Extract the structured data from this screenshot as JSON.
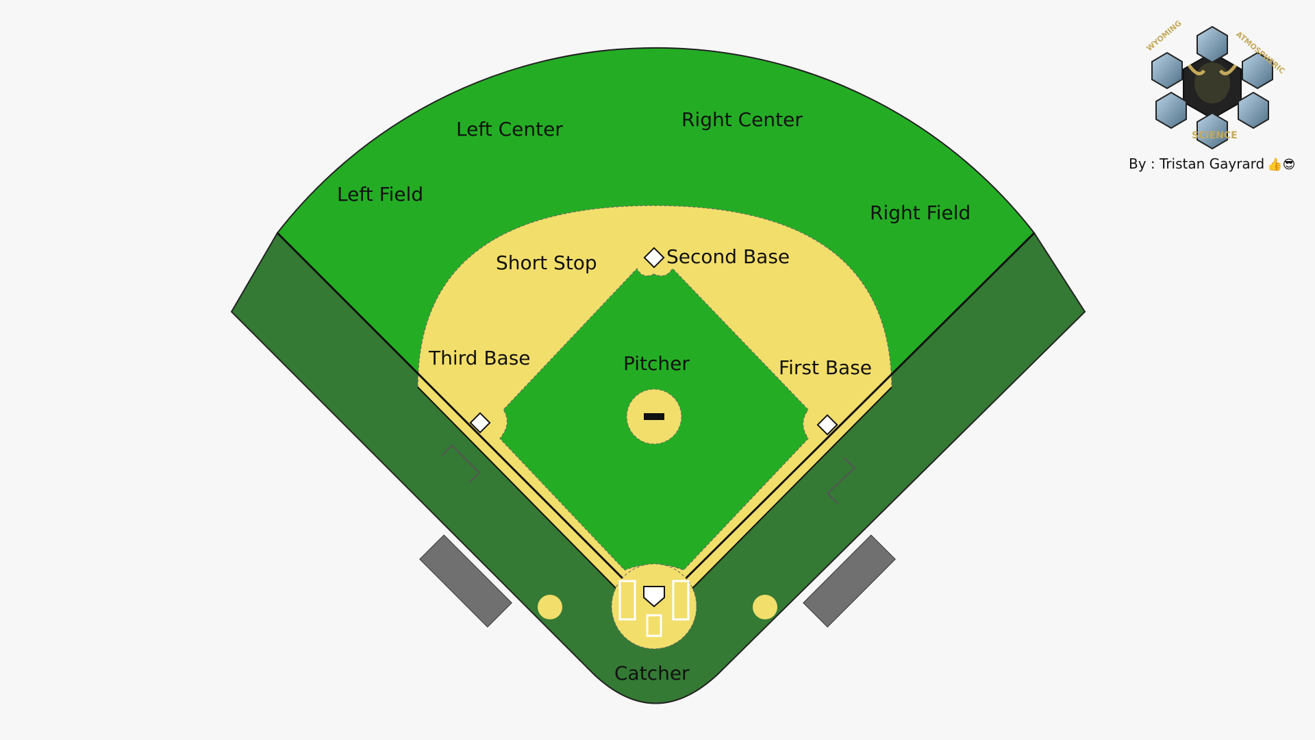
{
  "positions": {
    "left_field": "Left Field",
    "left_center": "Left Center",
    "right_center": "Right Center",
    "right_field": "Right Field",
    "short_stop": "Short Stop",
    "second_base": "Second Base",
    "third_base": "Third Base",
    "pitcher": "Pitcher",
    "first_base": "First Base",
    "catcher": "Catcher"
  },
  "logo": {
    "text_left": "WYOMING",
    "text_right": "ATMOSPHERIC",
    "text_bottom": "SCIENCE"
  },
  "author": {
    "text": "By : Tristan Gayrard",
    "emojis": "👍😎"
  },
  "colors": {
    "background": "#f7f7f7",
    "outfield_grass": "#24ad24",
    "foul_territory": "#347a34",
    "infield_dirt": "#f2de6b",
    "dugout": "#707070"
  }
}
